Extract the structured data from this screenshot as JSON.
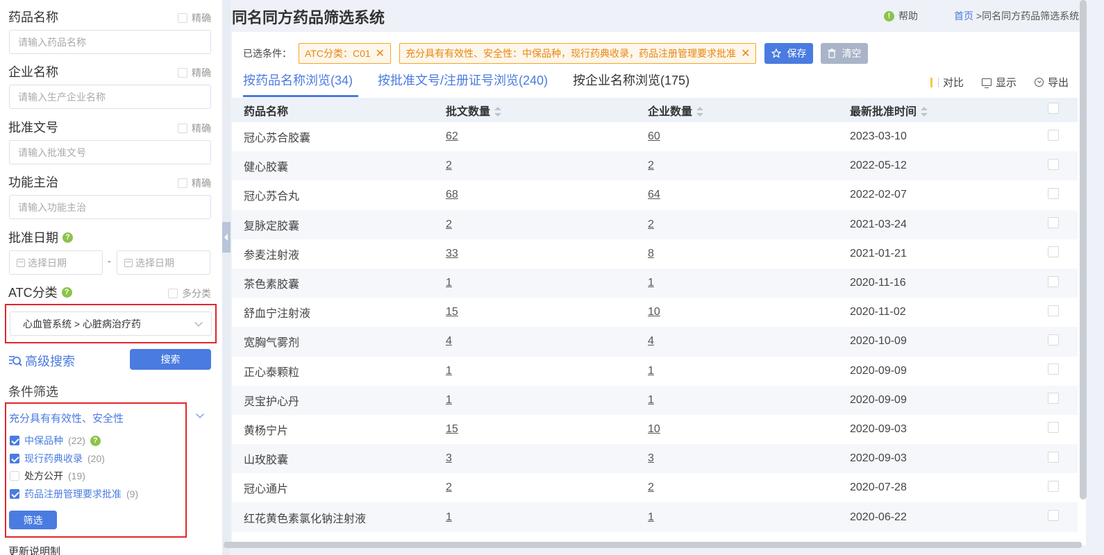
{
  "sidebar": {
    "drug_name": {
      "label": "药品名称",
      "exact": "精确",
      "placeholder": "请输入药品名称"
    },
    "company_name": {
      "label": "企业名称",
      "exact": "精确",
      "placeholder": "请输入生产企业名称"
    },
    "approval_no": {
      "label": "批准文号",
      "exact": "精确",
      "placeholder": "请输入批准文号"
    },
    "indication": {
      "label": "功能主治",
      "exact": "精确",
      "placeholder": "请输入功能主治"
    },
    "approval_date": {
      "label": "批准日期",
      "help": "?",
      "start_placeholder": "选择日期",
      "end_placeholder": "选择日期",
      "dash": "-"
    },
    "atc": {
      "label": "ATC分类",
      "help": "?",
      "multi": "多分类",
      "selected": "心血管系统 > 心脏病治疗药"
    },
    "advanced_search": "高级搜索",
    "search_button": "搜索",
    "filter_title": "条件筛选",
    "filter_group": {
      "title": "充分具有有效性、安全性",
      "options": [
        {
          "label": "中保品种",
          "count": "(22)",
          "checked": true,
          "help": "?"
        },
        {
          "label": "现行药典收录",
          "count": "(20)",
          "checked": true
        },
        {
          "label": "处方公开",
          "count": "(19)",
          "checked": false
        },
        {
          "label": "药品注册管理要求批准",
          "count": "(9)",
          "checked": true
        }
      ],
      "button": "筛选"
    },
    "next_group_cut": "更新说明制"
  },
  "header": {
    "title": "同名同方药品筛选系统",
    "help": "帮助",
    "help_icon": "!",
    "breadcrumb_home": "首页",
    "breadcrumb_sep": ">",
    "breadcrumb_current": "同名同方药品筛选系统"
  },
  "selected": {
    "label": "已选条件：",
    "tags": [
      "ATC分类：C01",
      "充分具有有效性、安全性：中保品种，现行药典收录，药品注册管理要求批准"
    ],
    "tag_close": "✕",
    "save": "保存",
    "clear": "清空"
  },
  "tabs": [
    {
      "label": "按药品名称浏览(34)",
      "active": true
    },
    {
      "label": "按批准文号/注册证号浏览(240)",
      "active": false
    },
    {
      "label": "按企业名称浏览(175)",
      "active": false
    }
  ],
  "tools": {
    "compare": "对比",
    "display": "显示",
    "export": "导出"
  },
  "table": {
    "headers": [
      "药品名称",
      "批文数量",
      "企业数量",
      "最新批准时间"
    ],
    "rows": [
      [
        "冠心苏合胶囊",
        "62",
        "60",
        "2023-03-10"
      ],
      [
        "健心胶囊",
        "2",
        "2",
        "2022-05-12"
      ],
      [
        "冠心苏合丸",
        "68",
        "64",
        "2022-02-07"
      ],
      [
        "复脉定胶囊",
        "2",
        "2",
        "2021-03-24"
      ],
      [
        "参麦注射液",
        "33",
        "8",
        "2021-01-21"
      ],
      [
        "茶色素胶囊",
        "1",
        "1",
        "2020-11-16"
      ],
      [
        "舒血宁注射液",
        "15",
        "10",
        "2020-11-02"
      ],
      [
        "宽胸气雾剂",
        "4",
        "4",
        "2020-10-09"
      ],
      [
        "正心泰颗粒",
        "1",
        "1",
        "2020-09-09"
      ],
      [
        "灵宝护心丹",
        "1",
        "1",
        "2020-09-09"
      ],
      [
        "黄杨宁片",
        "15",
        "10",
        "2020-09-03"
      ],
      [
        "山玫胶囊",
        "3",
        "3",
        "2020-09-03"
      ],
      [
        "冠心通片",
        "2",
        "2",
        "2020-07-28"
      ],
      [
        "红花黄色素氯化钠注射液",
        "1",
        "1",
        "2020-06-22"
      ]
    ]
  },
  "colors": {
    "accent": "#4a7be0",
    "tag": "#e8870f",
    "highlight": "#e0262b",
    "help": "#8bc34a"
  }
}
